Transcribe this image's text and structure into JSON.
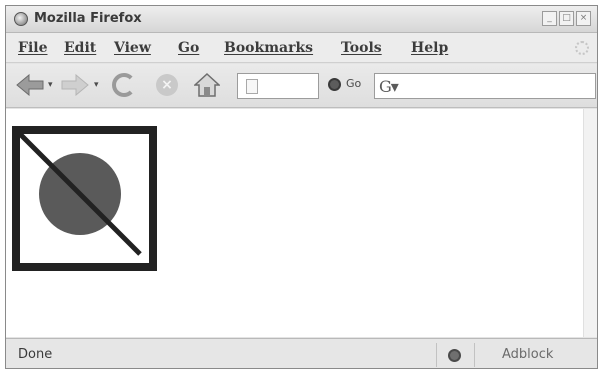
{
  "window": {
    "title": "Mozilla Firefox",
    "controls": {
      "minimize": "_",
      "maximize": "□",
      "close": "×"
    }
  },
  "menu": {
    "items": [
      "File",
      "Edit",
      "View",
      "Go",
      "Bookmarks",
      "Tools",
      "Help"
    ]
  },
  "toolbar": {
    "go_label": "Go",
    "address_value": "",
    "search_value": ""
  },
  "statusbar": {
    "status_text": "Done",
    "adblock_label": "Adblock"
  },
  "colors": {
    "circle_fill": "#5a5a5a",
    "frame": "#222222"
  },
  "icons": [
    "back-arrow-icon",
    "forward-arrow-icon",
    "reload-icon",
    "stop-icon",
    "home-icon",
    "page-icon",
    "go-icon",
    "search-engine-icon",
    "firefox-logo-icon"
  ]
}
